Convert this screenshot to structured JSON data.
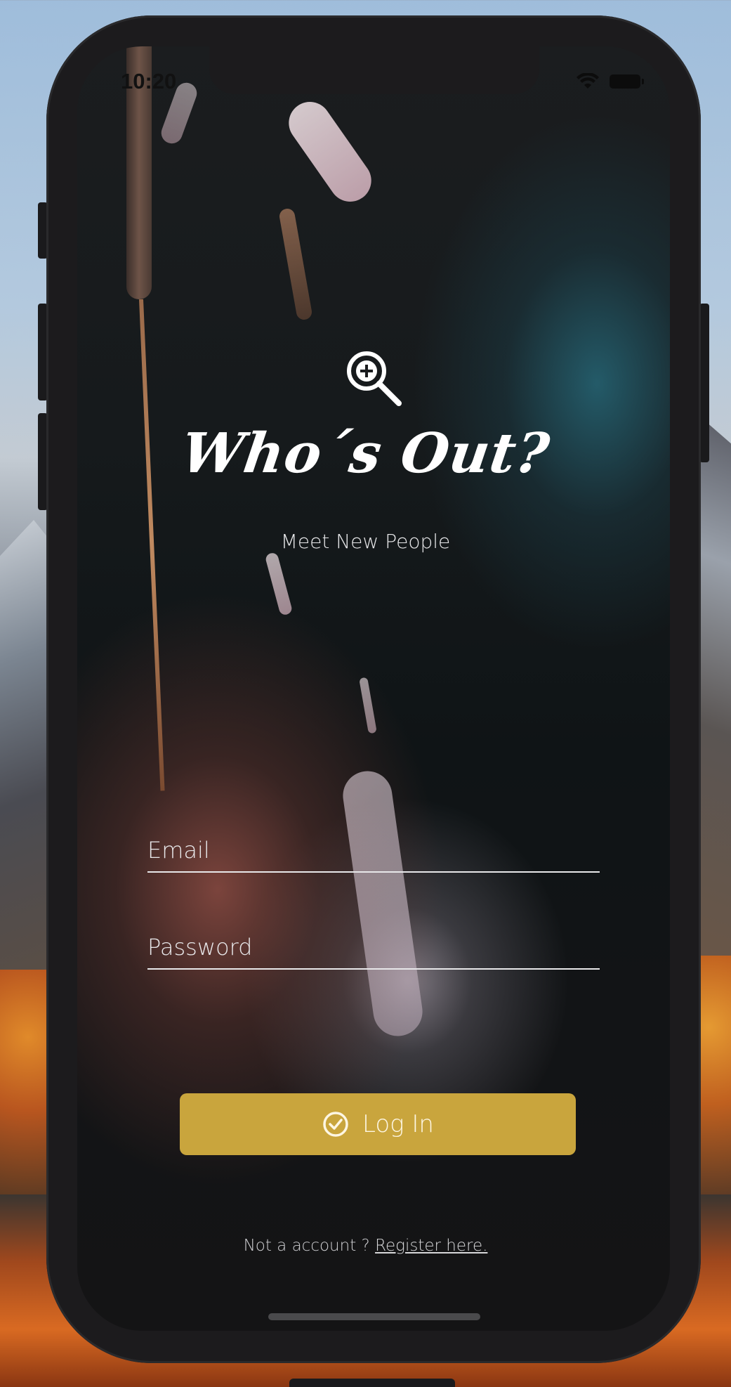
{
  "status_bar": {
    "time": "10:20",
    "wifi_icon": "wifi-icon",
    "battery_icon": "battery-icon"
  },
  "app": {
    "logo_icon": "zoom-in-magnifier-icon",
    "title": "Who´s Out?",
    "subtitle": "Meet New People"
  },
  "form": {
    "email": {
      "placeholder": "Email",
      "value": ""
    },
    "password": {
      "placeholder": "Password",
      "value": ""
    },
    "login_label": "Log In",
    "login_icon": "check-circle-icon"
  },
  "footer": {
    "text": "Not a account ? ",
    "register_link": "Register here."
  },
  "colors": {
    "accent": "#c9a53d",
    "text": "#ffffff"
  }
}
